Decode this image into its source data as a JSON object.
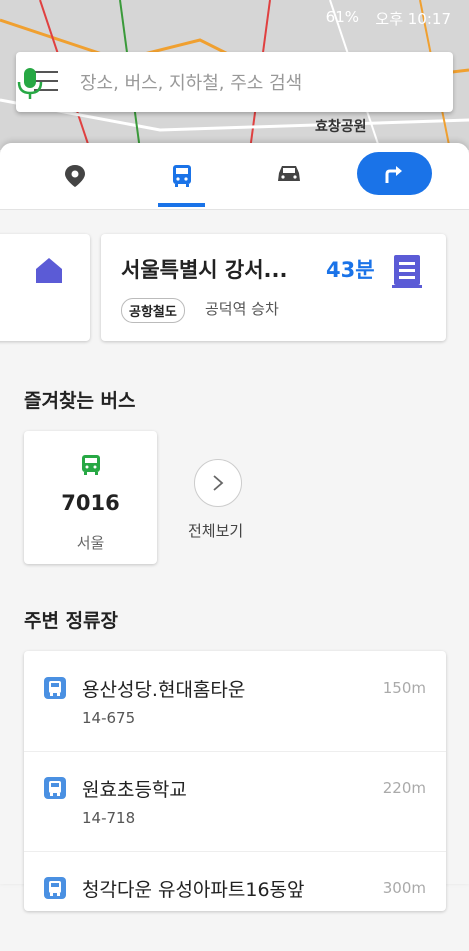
{
  "status_bar": {
    "battery": "61%",
    "time": "오후 10:17"
  },
  "map": {
    "labels": [
      "효창공원"
    ]
  },
  "search": {
    "placeholder": "장소, 버스, 지하철, 주소 검색"
  },
  "tabs": [
    {
      "name": "place",
      "icon": "place-pin-icon"
    },
    {
      "name": "transit",
      "icon": "bus-icon",
      "active": true
    },
    {
      "name": "car",
      "icon": "car-icon"
    },
    {
      "name": "route",
      "icon": "route-arrow-icon"
    }
  ],
  "destination": {
    "title": "서울특별시 강서...",
    "time": "43분",
    "line_chip": "공항철도",
    "boarding": "공덕역 승차"
  },
  "favorite_bus": {
    "section_title": "즐겨찾는 버스",
    "bus_number": "7016",
    "region": "서울",
    "view_all": "전체보기"
  },
  "nearby_stops": {
    "section_title": "주변 정류장",
    "items": [
      {
        "name": "용산성당.현대홈타운",
        "code": "14-675",
        "distance": "150m"
      },
      {
        "name": "원효초등학교",
        "code": "14-718",
        "distance": "220m"
      },
      {
        "name": "청각다운 유성아파트16동앞",
        "code": "",
        "distance": "300m"
      }
    ]
  },
  "colors": {
    "accent": "#1a73e8",
    "home": "#5b5bd6",
    "bus_green": "#27a844",
    "stop_blue": "#4a90e2"
  }
}
